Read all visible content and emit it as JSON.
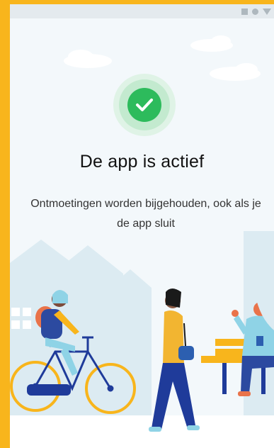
{
  "status": {
    "title": "De app is actief",
    "message": "Ontmoetingen worden bijgehouden, ook als je de app sluit"
  },
  "icons": {
    "status_icon": "check-circle-icon",
    "system_icons": [
      "signal-icon",
      "battery-icon",
      "wifi-icon"
    ]
  },
  "colors": {
    "accent_green": "#2dbb5c",
    "frame_border": "#f8b51c",
    "background": "#f3f8fb"
  }
}
